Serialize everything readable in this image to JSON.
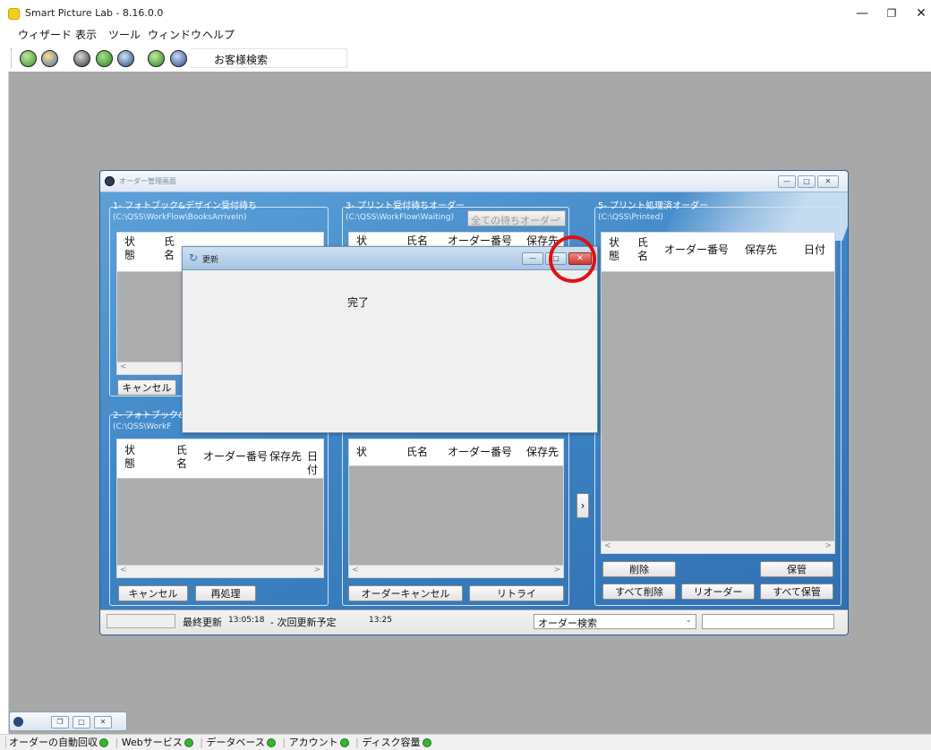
{
  "app": {
    "title": "Smart Picture Lab - 8.16.0.0",
    "menu": [
      "ウィザード",
      "表示",
      "ツール",
      "ウィンドウ",
      "ヘルプ"
    ],
    "toolbar_search_label": "お客様検索"
  },
  "order_window": {
    "title": "オーダー管理画面",
    "panel1": {
      "title": "1- フォトブック&デザイン受付待ち",
      "path": "(C:\\QSS\\WorkFlow\\BooksArriveIn)",
      "col_status": "状\n態",
      "col_name": "氏\n名",
      "cancel": "キャンセル"
    },
    "panel2": {
      "title": "2- フォトブック&",
      "path": "(C:\\QSS\\WorkF",
      "columns": [
        "状\n態",
        "氏\n名",
        "オーダー番号",
        "保存先",
        "日付"
      ],
      "cancel": "キャンセル",
      "reprocess": "再処理"
    },
    "panel3": {
      "title": "3- プリント受付待ちオーダー",
      "path": "(C:\\QSS\\WorkFlow\\Waiting)",
      "dropdown": "全ての待ちオーダー",
      "columns_top": [
        "状",
        "氏名",
        "オーダー番号",
        "保存先"
      ],
      "columns_bottom": [
        "状",
        "氏名",
        "オーダー番号",
        "保存先"
      ],
      "order_cancel": "オーダーキャンセル",
      "retry": "リトライ"
    },
    "panel5": {
      "title": "5- プリント処理済オーダー",
      "path": "(C:\\QSS\\Printed)",
      "columns": [
        "状\n態",
        "氏\n名",
        "オーダー番号",
        "保存先",
        "日付"
      ],
      "delete": "削除",
      "store": "保管",
      "delete_all": "すべて削除",
      "reorder": "リオーダー",
      "store_all": "すべて保管"
    },
    "arrow": "›",
    "scroll_left": "<",
    "scroll_right": ">",
    "status": {
      "last_update_label": "最終更新",
      "last_update_time": "13:05:18",
      "next_update_label": "- 次回更新予定",
      "next_update_time": "13:25",
      "order_search": "オーダー検索",
      "search_value": ""
    }
  },
  "dialog": {
    "title": "更新",
    "message": "完了"
  },
  "taskbar_tab": {
    "label": ""
  },
  "statusbar": {
    "items": [
      "オーダーの自動回収",
      "Webサービス",
      "データベース",
      "アカウント",
      "ディスク容量"
    ],
    "status_color": "#37b431"
  },
  "colors": {
    "blue_window": "#4a90cc",
    "highlight_circle": "#e01010",
    "dialog_close": "#d9423a"
  }
}
